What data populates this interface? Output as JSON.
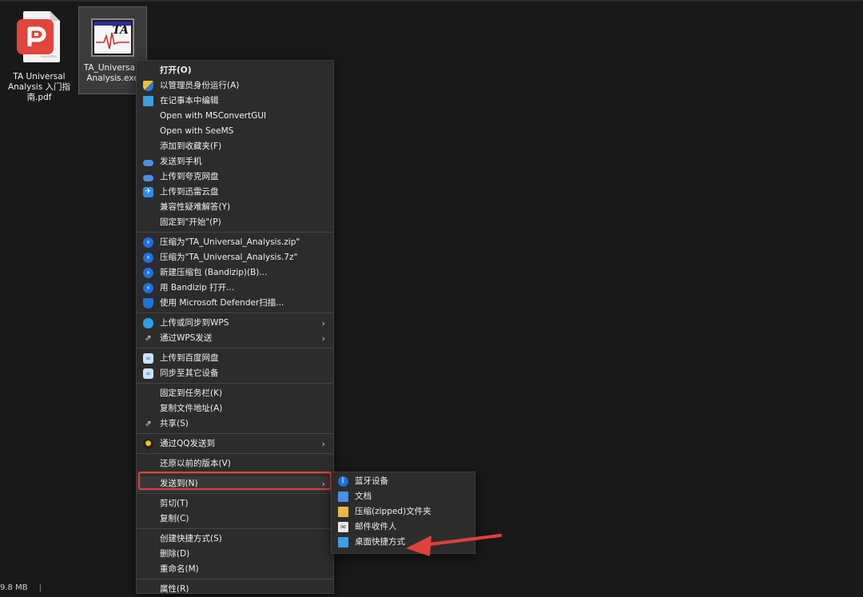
{
  "desktop": {
    "icons": [
      {
        "label": "TA Universal Analysis 入门指南.pdf"
      },
      {
        "label": "TA_Universal_Analysis.exe"
      }
    ]
  },
  "exe_icon_text": "TA",
  "context_menu": {
    "groups": [
      [
        {
          "label": "打开(O)",
          "icon": "",
          "bold": true
        },
        {
          "label": "以管理员身份运行(A)",
          "icon": "uac-shield-icon"
        },
        {
          "label": "在记事本中编辑",
          "icon": "notepad-icon"
        },
        {
          "label": "Open with MSConvertGUI",
          "icon": ""
        },
        {
          "label": "Open with SeeMS",
          "icon": ""
        },
        {
          "label": "添加到收藏夹(F)",
          "icon": ""
        },
        {
          "label": "发送到手机",
          "icon": "cloud-icon"
        },
        {
          "label": "上传到夸克网盘",
          "icon": "cloud-icon"
        },
        {
          "label": "上传到迅雷云盘",
          "icon": "bird-icon"
        },
        {
          "label": "兼容性疑难解答(Y)",
          "icon": ""
        },
        {
          "label": "固定到\"开始\"(P)",
          "icon": ""
        }
      ],
      [
        {
          "label": "压缩为\"TA_Universal_Analysis.zip\"",
          "icon": "bandizip-icon"
        },
        {
          "label": "压缩为\"TA_Universal_Analysis.7z\"",
          "icon": "bandizip-icon"
        },
        {
          "label": "新建压缩包 (Bandizip)(B)...",
          "icon": "bandizip-icon"
        },
        {
          "label": "用 Bandizip 打开...",
          "icon": "bandizip-icon"
        },
        {
          "label": "使用 Microsoft Defender扫描...",
          "icon": "defender-shield-icon"
        }
      ],
      [
        {
          "label": "上传或同步到WPS",
          "icon": "wps-cloud-icon",
          "submenu": true
        },
        {
          "label": "通过WPS发送",
          "icon": "share-icon",
          "submenu": true
        }
      ],
      [
        {
          "label": "上传到百度网盘",
          "icon": "baidu-icon"
        },
        {
          "label": "同步至其它设备",
          "icon": "baidu-icon"
        }
      ],
      [
        {
          "label": "固定到任务栏(K)",
          "icon": ""
        },
        {
          "label": "复制文件地址(A)",
          "icon": ""
        },
        {
          "label": "共享(S)",
          "icon": "share-icon"
        }
      ],
      [
        {
          "label": "通过QQ发送到",
          "icon": "qq-icon",
          "submenu": true
        }
      ],
      [
        {
          "label": "还原以前的版本(V)",
          "icon": ""
        }
      ],
      [
        {
          "label": "发送到(N)",
          "icon": "",
          "submenu": true,
          "highlight": true
        }
      ],
      [
        {
          "label": "剪切(T)",
          "icon": ""
        },
        {
          "label": "复制(C)",
          "icon": ""
        }
      ],
      [
        {
          "label": "创建快捷方式(S)",
          "icon": ""
        },
        {
          "label": "删除(D)",
          "icon": ""
        },
        {
          "label": "重命名(M)",
          "icon": ""
        }
      ],
      [
        {
          "label": "属性(R)",
          "icon": ""
        }
      ]
    ]
  },
  "send_to_menu": {
    "items": [
      {
        "label": "蓝牙设备",
        "icon": "bluetooth-icon"
      },
      {
        "label": "文档",
        "icon": "documents-icon"
      },
      {
        "label": "压缩(zipped)文件夹",
        "icon": "zip-folder-icon"
      },
      {
        "label": "邮件收件人",
        "icon": "mail-icon"
      },
      {
        "label": "桌面快捷方式",
        "icon": "desktop-icon"
      }
    ]
  },
  "status_bar": {
    "size": "9.8 MB",
    "separator": "|"
  },
  "colors": {
    "highlight_border": "#e0403a",
    "arrow": "#e0403a",
    "menu_bg": "#2c2c2c",
    "desktop_bg": "#191919"
  }
}
